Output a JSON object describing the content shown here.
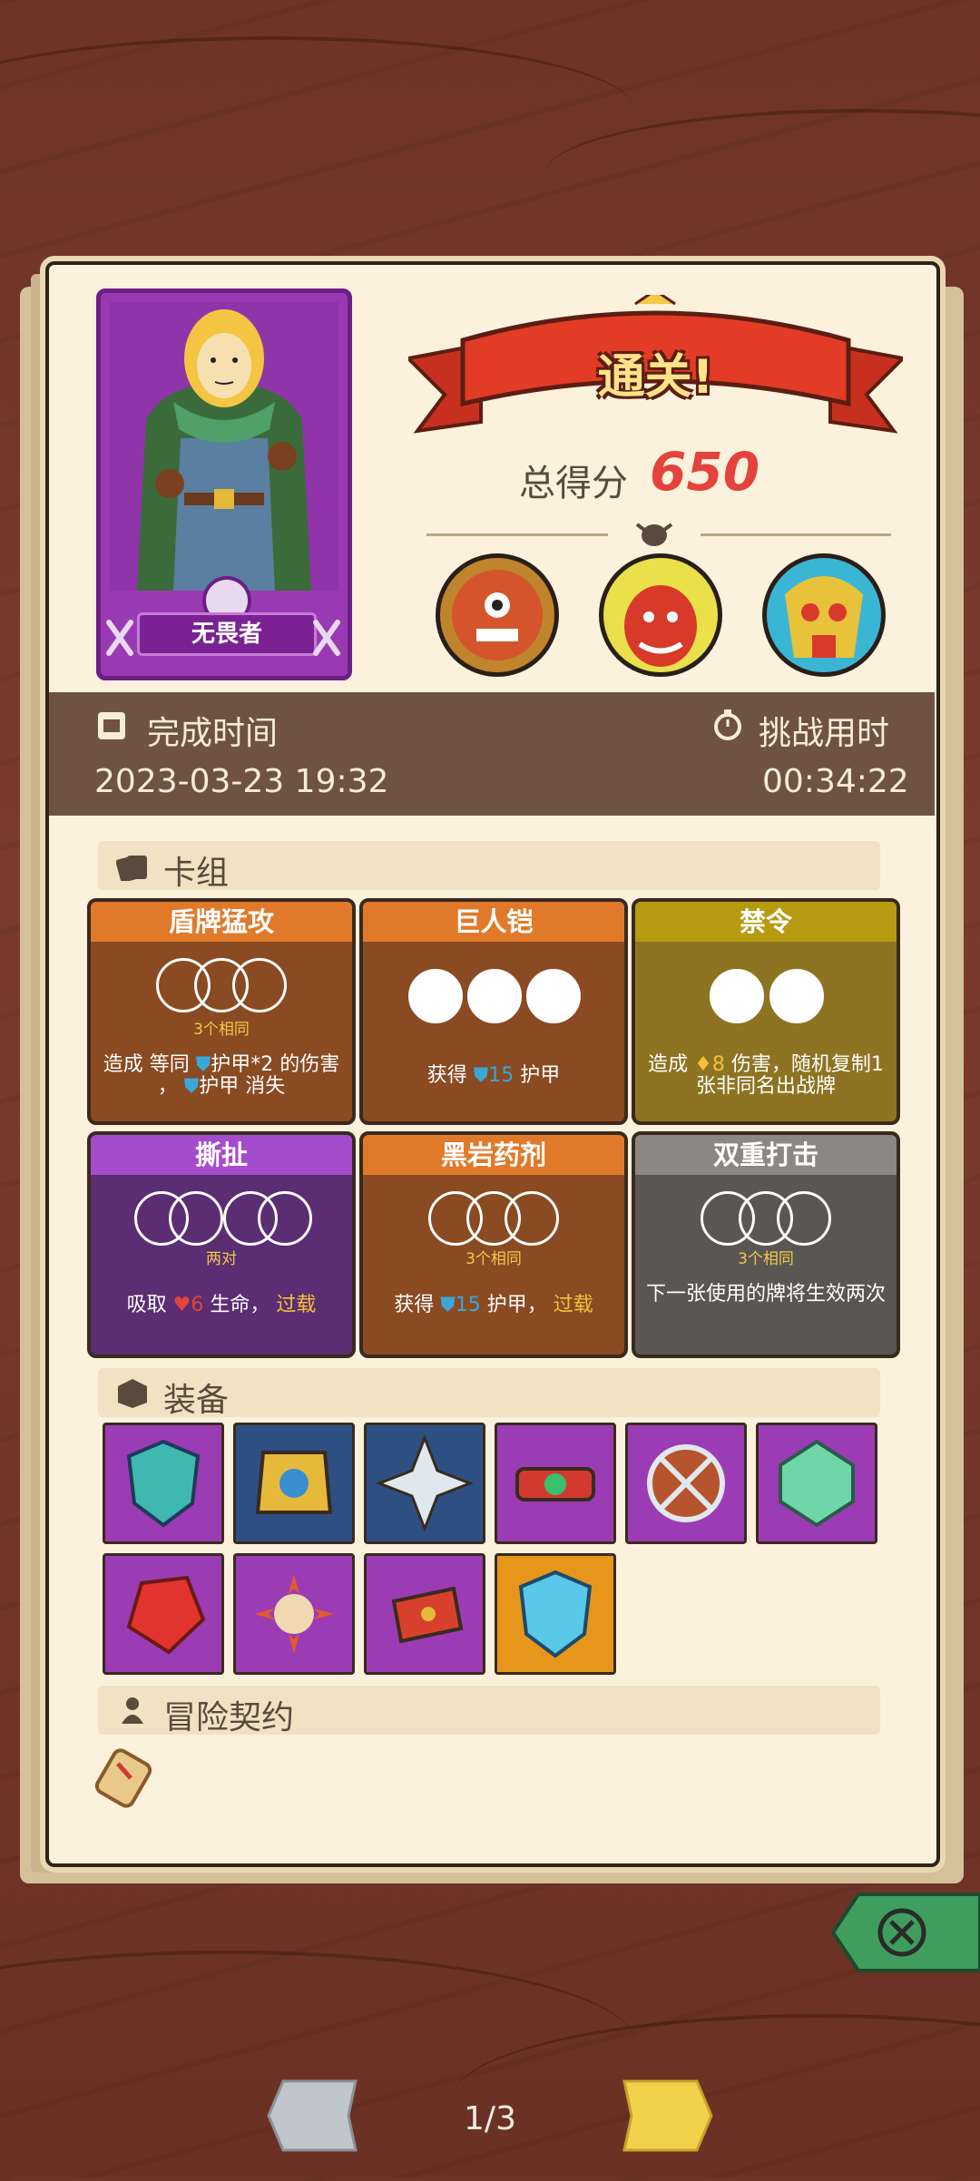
{
  "hero": {
    "name": "无畏者"
  },
  "result": {
    "banner": "通关!",
    "score_label": "总得分",
    "score": "650"
  },
  "bosses": [
    {
      "icon": "cyclops-boss-icon"
    },
    {
      "icon": "red-demon-boss-icon"
    },
    {
      "icon": "bone-mask-boss-icon"
    }
  ],
  "times": {
    "finish_label": "完成时间",
    "finish_value": "2023-03-23 19:32",
    "challenge_label": "挑战用时",
    "challenge_value": "00:34:22"
  },
  "sections": {
    "deck": "卡组",
    "equipment": "装备",
    "contract": "冒险契约"
  },
  "cards": [
    {
      "title": "盾牌猛攻",
      "count_label": "3个相同",
      "desc1": "造成 等同",
      "desc2": "护甲*2 的伤害",
      "desc3": "，",
      "desc4": "护甲 消失"
    },
    {
      "title": "巨人铠",
      "desc_pre": "获得",
      "value": "15",
      "desc_post": "护甲"
    },
    {
      "title": "禁令",
      "desc_pre": "造成",
      "value": "8",
      "desc_post": "伤害，随机复制1张非同名出战牌"
    },
    {
      "title": "撕扯",
      "count_label": "两对",
      "desc_pre": "吸取",
      "value": "6",
      "desc_mid": "生命，",
      "desc_hl": "过载"
    },
    {
      "title": "黑岩药剂",
      "count_label": "3个相同",
      "desc_pre": "获得",
      "value": "15",
      "desc_mid": "护甲，",
      "desc_hl": "过载"
    },
    {
      "title": "双重打击",
      "count_label": "3个相同",
      "desc": "下一张使用的牌将生效两次"
    }
  ],
  "equipment_icons": [
    "beast-shield-icon",
    "chest-armor-icon",
    "cross-emblem-icon",
    "belt-icon",
    "round-shield-icon",
    "crystal-icon",
    "ruby-icon",
    "sun-emblem-icon",
    "bracer-icon",
    "ice-shield-icon"
  ],
  "pager": {
    "label": "1/3"
  },
  "colors": {
    "parchment": "#fbf1dc",
    "wood": "#6e3427",
    "score": "#e4423c"
  }
}
